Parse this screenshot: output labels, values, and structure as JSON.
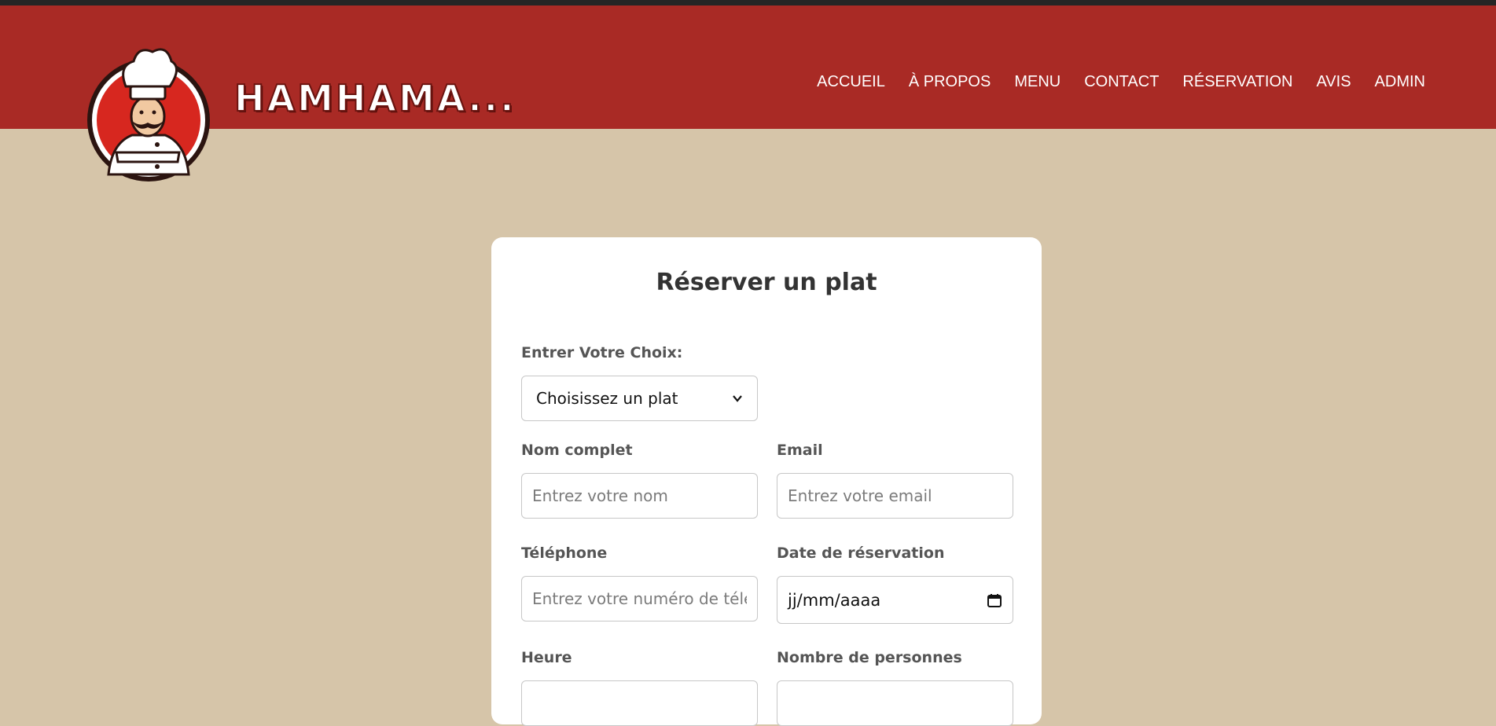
{
  "brand": {
    "name": "HAMHAMA..."
  },
  "nav": {
    "items": [
      {
        "label": "ACCUEIL"
      },
      {
        "label": "À PROPOS"
      },
      {
        "label": "MENU"
      },
      {
        "label": "CONTACT"
      },
      {
        "label": "RÉSERVATION"
      },
      {
        "label": "AVIS"
      },
      {
        "label": "ADMIN"
      }
    ]
  },
  "form": {
    "title": "Réserver un plat",
    "choice": {
      "label": "Entrer Votre Choix:",
      "value": "Choisissez un plat"
    },
    "name": {
      "label": "Nom complet",
      "placeholder": "Entrez votre nom"
    },
    "email": {
      "label": "Email",
      "placeholder": "Entrez votre email"
    },
    "phone": {
      "label": "Téléphone",
      "placeholder": "Entrez votre numéro de télé"
    },
    "date": {
      "label": "Date de réservation",
      "value": "jj/mm/aaaa"
    },
    "time": {
      "label": "Heure"
    },
    "people": {
      "label": "Nombre de personnes"
    }
  },
  "colors": {
    "navbar": "#a92a25",
    "background": "#d6c5a9",
    "card": "#ffffff",
    "label": "#555555"
  }
}
